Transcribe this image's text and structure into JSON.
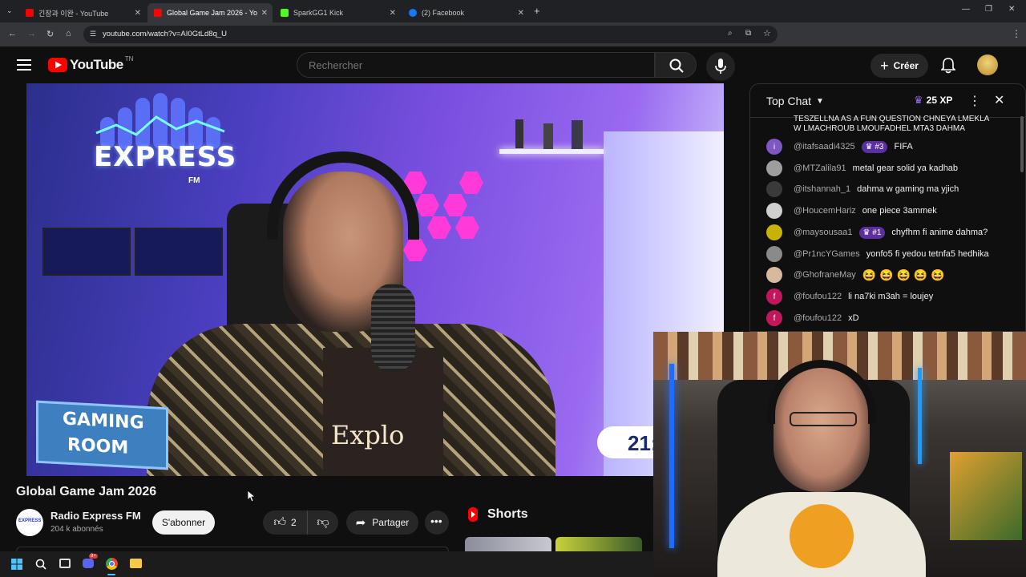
{
  "browser": {
    "tabs": [
      {
        "title": "긴장과 이완 - YouTube",
        "active": false,
        "favicon_color": "#ff0000"
      },
      {
        "title": "Global Game Jam 2026 - Yo",
        "active": true,
        "favicon_color": "#ff0000"
      },
      {
        "title": "SparkGG1 Kick",
        "active": false,
        "favicon_color": "#53fc18"
      },
      {
        "title": "(2) Facebook",
        "active": false,
        "favicon_color": "#1877f2"
      }
    ],
    "url": "youtube.com/watch?v=AI0GtLd8q_U"
  },
  "header": {
    "logo_text": "YouTube",
    "logo_suffix": "TN",
    "search_placeholder": "Rechercher",
    "create_label": "Créer"
  },
  "chat": {
    "title": "Top Chat",
    "xp": "25 XP",
    "pinned_text_line1": "TESZELLNA AS A FUN QUESTION CHNEYA LMEKLA",
    "pinned_text_line2": "W LMACHROUB LMOUFADHEL MTA3 DAHMA",
    "messages": [
      {
        "author": "@itafsaadi4325",
        "badge": "#3",
        "text": "FIFA",
        "avatar_color": "#7e57c2",
        "avatar_letter": "i"
      },
      {
        "author": "@MTZalila91",
        "badge": "",
        "text": "metal gear solid ya kadhab",
        "avatar_color": "#9e9e9e",
        "avatar_letter": ""
      },
      {
        "author": "@itshannah_1",
        "badge": "",
        "text": "dahma w gaming ma yjich",
        "avatar_color": "#3a3a3a",
        "avatar_letter": ""
      },
      {
        "author": "@HoucemHariz",
        "badge": "",
        "text": "one piece 3ammek",
        "avatar_color": "#cfcfcf",
        "avatar_letter": ""
      },
      {
        "author": "@maysousaa1",
        "badge": "#1",
        "text": "chyfhm fi anime dahma?",
        "avatar_color": "#c8b400",
        "avatar_letter": ""
      },
      {
        "author": "@Pr1ncYGames",
        "badge": "",
        "text": "yonfo5 fi yedou tetnfa5 hedhika",
        "avatar_color": "#8a8a8a",
        "avatar_letter": ""
      },
      {
        "author": "@GhofraneMay",
        "badge": "",
        "text": "😆 😆 😆 😆 😆",
        "avatar_color": "#d7b9a0",
        "avatar_letter": ""
      },
      {
        "author": "@foufou122",
        "badge": "",
        "text": "li na7ki m3ah = loujey",
        "avatar_color": "#c2185b",
        "avatar_letter": "f"
      },
      {
        "author": "@foufou122",
        "badge": "",
        "text": "xD",
        "avatar_color": "#c2185b",
        "avatar_letter": "f"
      }
    ]
  },
  "video": {
    "brand_text": "EXPRESS",
    "brand_sub": "FM",
    "gaming_line1": "GAMING",
    "gaming_line2": "ROOM",
    "shirt_text": "Explo",
    "clock_text": "21:",
    "title": "Global Game Jam 2026"
  },
  "channel": {
    "name": "Radio Express FM",
    "subscribers": "204 k abonnés",
    "subscribe_label": "S'abonner",
    "avatar_text": "EXPRESS"
  },
  "actions": {
    "like_count": "2",
    "share_label": "Partager"
  },
  "shorts": {
    "title": "Shorts"
  },
  "taskbar": {
    "discord_badge": "9+"
  },
  "colors": {
    "yt_red": "#ff0000",
    "accent_purple": "#7b5ce0",
    "chat_badge": "#5b2fa0"
  }
}
